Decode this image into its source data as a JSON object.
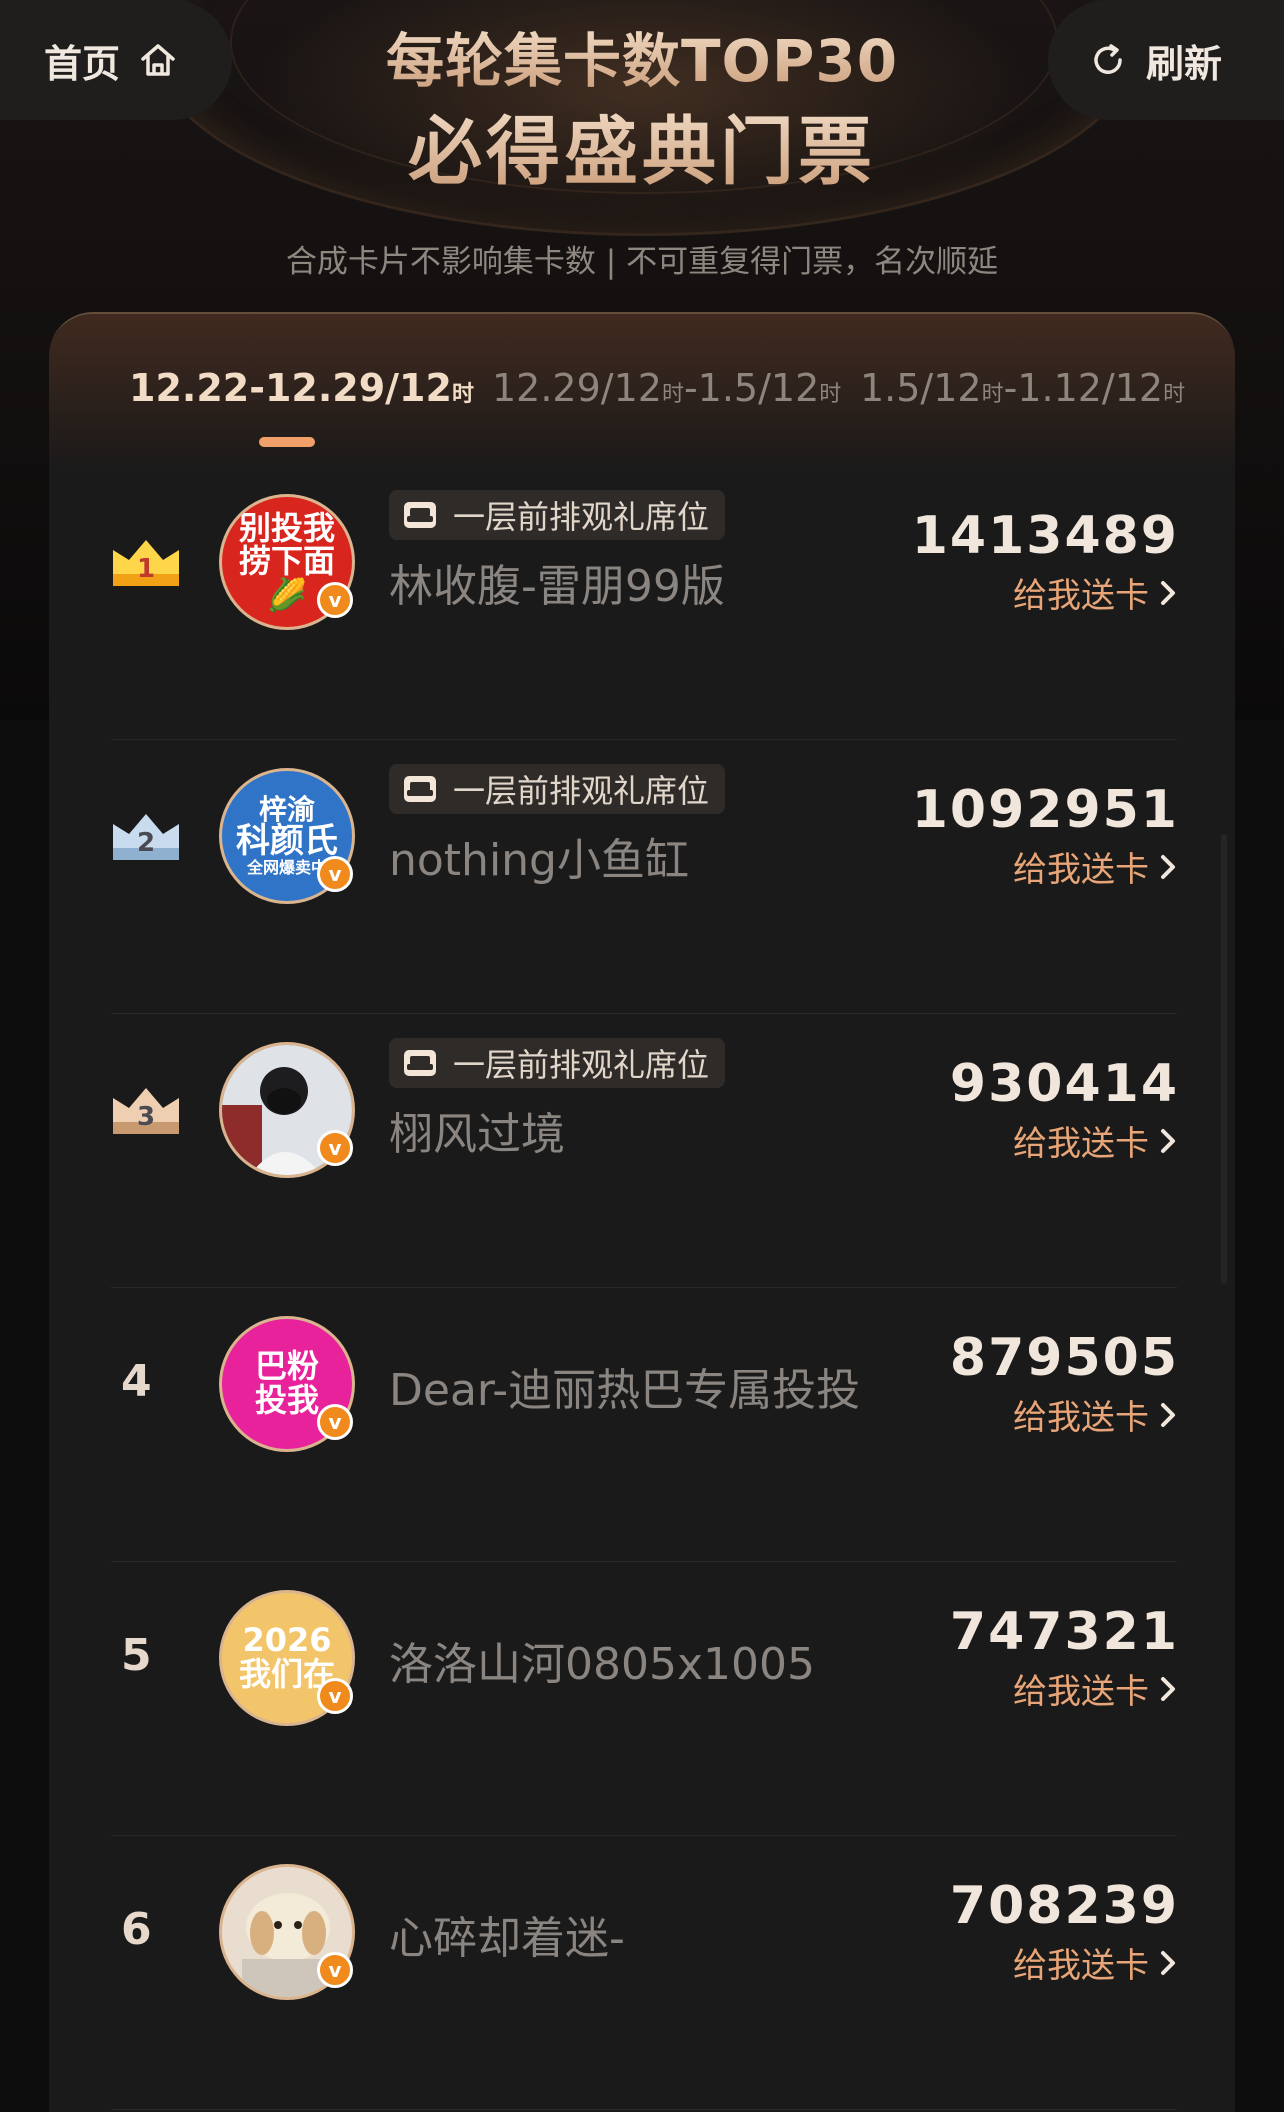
{
  "header": {
    "home_label": "首页",
    "home_icon": "home-icon",
    "refresh_label": "刷新",
    "refresh_icon": "refresh-icon",
    "title_line1": "每轮集卡数TOP30",
    "title_line2": "必得盛典门票",
    "subtitle": "合成卡片不影响集卡数 | 不可重复得门票，名次顺延"
  },
  "tabs": [
    {
      "a": "12.22-12.29/12",
      "b": "时",
      "active": true
    },
    {
      "a": "12.29/12",
      "b": "时",
      "c": "-1.5/12",
      "d": "时",
      "active": false
    },
    {
      "a": "1.5/12",
      "b": "时",
      "c": "-1.12/12",
      "d": "时",
      "active": false
    }
  ],
  "seat_label": "一层前排观礼席位",
  "send_label": "给我送卡",
  "colors": {
    "accent": "#e8a577",
    "tab_underline": "#f2a06a",
    "verify": "#f08a1c"
  },
  "ranking": [
    {
      "rank": "1",
      "crown": "gold",
      "name": "林收腹-雷朋99版",
      "count": "1413489",
      "seat": true,
      "avatar": {
        "lines": [
          "别投我",
          "捞下面🌽"
        ],
        "bg": "#d8261f"
      }
    },
    {
      "rank": "2",
      "crown": "silver",
      "name": "nothing小鱼缸",
      "count": "1092951",
      "seat": true,
      "avatar": {
        "lines": [
          "梓渝",
          "科颜氏",
          "全网爆卖中"
        ],
        "bg": "#2f74c7"
      }
    },
    {
      "rank": "3",
      "crown": "bronze",
      "name": "栩风过境",
      "count": "930414",
      "seat": true,
      "avatar": {
        "lines": [],
        "bg": "#5b6b7d"
      }
    },
    {
      "rank": "4",
      "crown": "",
      "name": "Dear-迪丽热巴专属投投",
      "count": "879505",
      "seat": false,
      "avatar": {
        "lines": [
          "巴粉",
          "投我"
        ],
        "bg": "#e8229a"
      }
    },
    {
      "rank": "5",
      "crown": "",
      "name": "洛洛山河0805x1005",
      "count": "747321",
      "seat": false,
      "avatar": {
        "lines": [
          "2026",
          "我们在"
        ],
        "bg": "#f3c56a"
      }
    },
    {
      "rank": "6",
      "crown": "",
      "name": "心碎却着迷-",
      "count": "708239",
      "seat": false,
      "avatar": {
        "lines": [],
        "bg": "#d9c3a3"
      }
    }
  ]
}
